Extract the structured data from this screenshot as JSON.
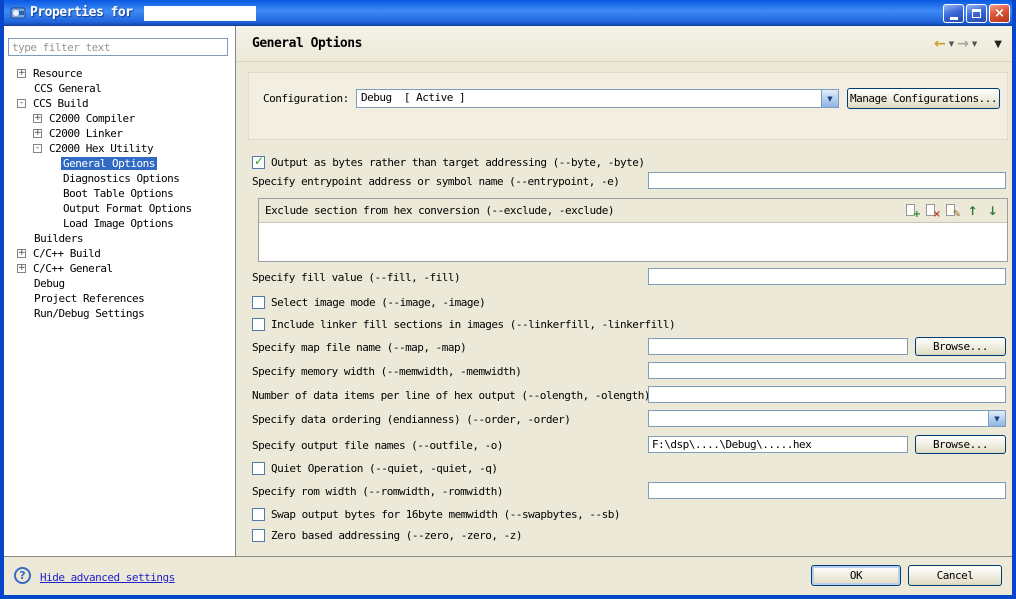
{
  "window": {
    "title": "Properties for"
  },
  "sidebar": {
    "filter_placeholder": "type filter text",
    "tree": [
      {
        "label": "Resource",
        "toggle": "+"
      },
      {
        "label": "CCS General",
        "toggle": ""
      },
      {
        "label": "CCS Build",
        "toggle": "-"
      },
      {
        "label": "C2000 Compiler",
        "toggle": "+"
      },
      {
        "label": "C2000 Linker",
        "toggle": "+"
      },
      {
        "label": "C2000 Hex Utility",
        "toggle": "-"
      },
      {
        "label": "General Options",
        "toggle": "",
        "selected": true
      },
      {
        "label": "Diagnostics Options",
        "toggle": ""
      },
      {
        "label": "Boot Table Options",
        "toggle": ""
      },
      {
        "label": "Output Format Options",
        "toggle": ""
      },
      {
        "label": "Load Image Options",
        "toggle": ""
      },
      {
        "label": "Builders",
        "toggle": ""
      },
      {
        "label": "C/C++ Build",
        "toggle": "+"
      },
      {
        "label": "C/C++ General",
        "toggle": "+"
      },
      {
        "label": "Debug",
        "toggle": ""
      },
      {
        "label": "Project References",
        "toggle": ""
      },
      {
        "label": "Run/Debug Settings",
        "toggle": ""
      }
    ]
  },
  "header": {
    "title": "General Options"
  },
  "config": {
    "label": "Configuration:",
    "value": "Debug  [ Active ]",
    "manage_label": "Manage Configurations..."
  },
  "form": {
    "byte": {
      "label": "Output as bytes rather than target addressing (--byte, -byte)",
      "checked": true,
      "glyph": "✓"
    },
    "entrypoint": {
      "label": "Specify entrypoint address or symbol name (--entrypoint, -e)",
      "value": ""
    },
    "exclude": {
      "title": "Exclude section from hex conversion (--exclude, -exclude)"
    },
    "fill": {
      "label": "Specify fill value (--fill, -fill)",
      "value": ""
    },
    "image": {
      "label": "Select image mode (--image, -image)",
      "checked": false,
      "glyph": ""
    },
    "linkerfill": {
      "label": "Include linker fill sections in images (--linkerfill, -linkerfill)",
      "checked": false,
      "glyph": ""
    },
    "map": {
      "label": "Specify map file name (--map, -map)",
      "value": "",
      "browse": "Browse..."
    },
    "memwidth": {
      "label": "Specify memory width (--memwidth, -memwidth)",
      "value": ""
    },
    "olength": {
      "label": "Number of data items per line of hex output (--olength, -olength)",
      "value": ""
    },
    "order": {
      "label": "Specify data ordering (endianness) (--order, -order)",
      "value": ""
    },
    "outfile": {
      "label": "Specify output file names (--outfile, -o)",
      "value": "F:\\dsp\\....\\Debug\\.....hex",
      "browse": "Browse..."
    },
    "quiet": {
      "label": "Quiet Operation (--quiet, -quiet, -q)",
      "checked": false,
      "glyph": ""
    },
    "romwidth": {
      "label": "Specify rom width (--romwidth, -romwidth)",
      "value": ""
    },
    "swapbytes": {
      "label": "Swap output bytes for 16byte memwidth (--swapbytes, --sb)",
      "checked": false,
      "glyph": ""
    },
    "zero": {
      "label": "Zero based addressing (--zero, -zero, -z)",
      "checked": false,
      "glyph": ""
    }
  },
  "footer": {
    "link": "Hide advanced settings",
    "ok": "OK",
    "cancel": "Cancel"
  },
  "icons": {
    "back": "←",
    "forward": "→",
    "dropdown": "▼",
    "menu": "▼",
    "combo_arrow": "▼",
    "close": "×",
    "help": "?",
    "add": "+",
    "remove": "×",
    "edit": "✎",
    "up": "↑",
    "down": "↓"
  },
  "colors": {
    "titlebar_blue": "#0A58E2",
    "selection_blue": "#316AC5",
    "dialog_bg": "#ECE9D8",
    "input_border": "#7F9DB9",
    "check_green": "#21A121",
    "link_blue": "#1F1FC8"
  }
}
